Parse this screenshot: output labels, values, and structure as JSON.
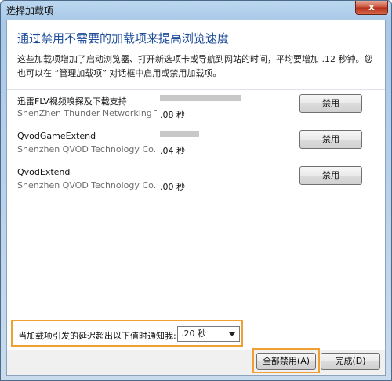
{
  "window": {
    "title": "选择加载项",
    "close_glyph": "x"
  },
  "header": {
    "heading": "通过禁用不需要的加载项来提高浏览速度",
    "description": "这些加载项增加了启动浏览器、打开新选项卡或导航到网站的时间，平均要增加 .12 秒钟。您也可以在 “管理加载项” 对话框中启用或禁用加载项。"
  },
  "addons": [
    {
      "name": "迅雷FLV视频嗅探及下载支持",
      "publisher": "ShenZhen Thunder Networking Te",
      "load_time": ".08 秒",
      "bar_fraction": 0.78,
      "disable_label": "禁用"
    },
    {
      "name": "QvodGameExtend",
      "publisher": "Shenzhen QVOD Technology Co.,L",
      "load_time": ".04 秒",
      "bar_fraction": 0.38,
      "disable_label": "禁用"
    },
    {
      "name": "QvodExtend",
      "publisher": "Shenzhen QVOD Technology Co.,L",
      "load_time": ".00 秒",
      "bar_fraction": 0,
      "disable_label": "禁用"
    }
  ],
  "notify": {
    "label": "当加载项引发的延迟超出以下值时通知我:",
    "selected": ".20 秒"
  },
  "footer": {
    "disable_all_label": "全部禁用(A)",
    "done_label": "完成(D)"
  },
  "colors": {
    "heading": "#1f4d9a",
    "highlight": "#f0a030",
    "bar": "#c8c8c8"
  }
}
